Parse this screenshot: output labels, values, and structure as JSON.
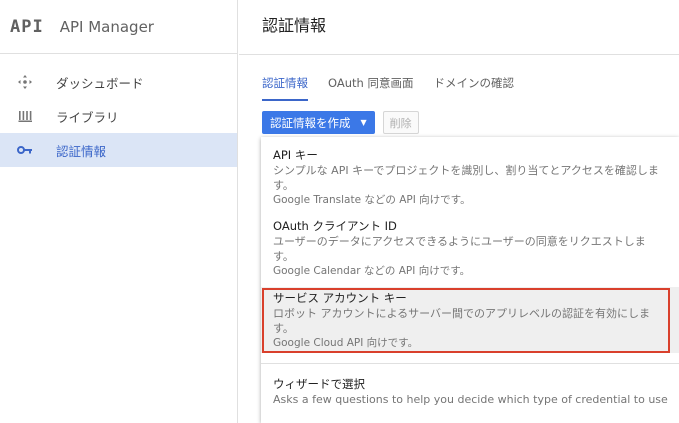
{
  "sidebar": {
    "logo": "API",
    "app_title": "API Manager",
    "items": [
      {
        "label": "ダッシュボード",
        "icon": "dashboard-icon"
      },
      {
        "label": "ライブラリ",
        "icon": "library-icon"
      },
      {
        "label": "認証情報",
        "icon": "key-icon",
        "active": true
      }
    ]
  },
  "main": {
    "title": "認証情報",
    "tabs": [
      {
        "label": "認証情報",
        "active": true
      },
      {
        "label": "OAuth 同意画面"
      },
      {
        "label": "ドメインの確認"
      }
    ],
    "toolbar": {
      "create_label": "認証情報を作成",
      "delete_label": "削除"
    },
    "menu": {
      "items": [
        {
          "title": "API キー",
          "desc_1": "シンプルな API キーでプロジェクトを識別し、割り当てとアクセスを確認しま",
          "desc_2": "す。",
          "sub": "Google Translate などの API 向けです。"
        },
        {
          "title": "OAuth クライアント ID",
          "desc_1": "ユーザーのデータにアクセスできるようにユーザーの同意をリクエストしま",
          "desc_2": "す。",
          "sub": "Google Calendar などの API 向けです。"
        },
        {
          "title": "サービス アカウント キー",
          "desc_1": "ロボット アカウントによるサーバー間でのアプリレベルの認証を有効にしま",
          "desc_2": "す。",
          "sub": "Google Cloud API 向けです。"
        },
        {
          "title": "ウィザードで選択",
          "desc_1": "Asks a few questions to help you decide which type of credential to use"
        }
      ]
    }
  },
  "colors": {
    "accent": "#3b78e7",
    "active_bg": "#dbe5f6",
    "highlight_border": "#d9402c"
  }
}
